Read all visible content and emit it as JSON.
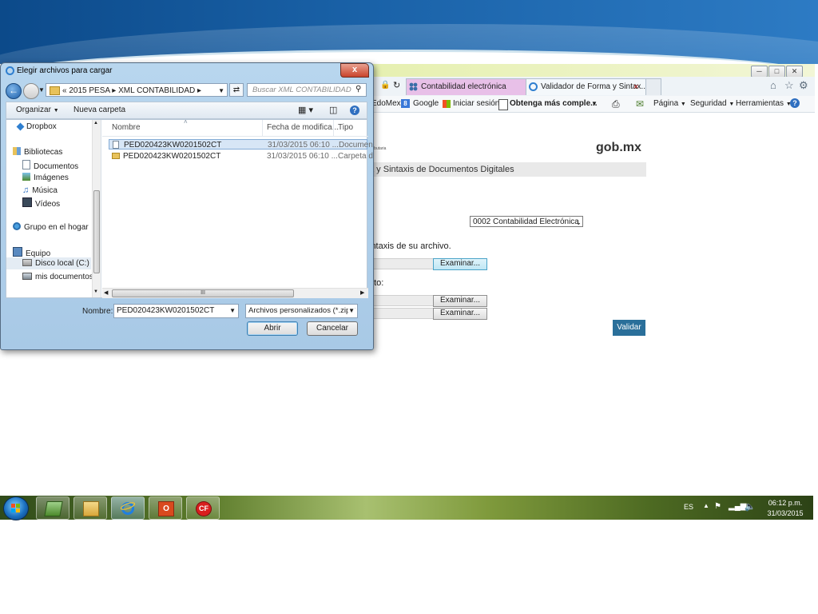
{
  "file_dialog": {
    "title": "Elegir archivos para cargar",
    "close_label": "x",
    "address_crumbs": [
      "«",
      "2015 PESA",
      "XML CONTABILIDAD"
    ],
    "search_placeholder": "Buscar XML CONTABILIDAD",
    "toolbar": {
      "organize_label": "Organizar",
      "new_folder_label": "Nueva carpeta"
    },
    "nav_items": [
      {
        "label": "Dropbox",
        "icon": "dropbox-icon"
      },
      {
        "label": "Bibliotecas",
        "icon": "libraries-icon"
      },
      {
        "label": "Documentos",
        "icon": "documents-icon"
      },
      {
        "label": "Imágenes",
        "icon": "pictures-icon"
      },
      {
        "label": "Música",
        "icon": "music-icon"
      },
      {
        "label": "Vídeos",
        "icon": "videos-icon"
      },
      {
        "label": "Grupo en el hogar",
        "icon": "homegroup-icon"
      },
      {
        "label": "Equipo",
        "icon": "computer-icon"
      },
      {
        "label": "Disco local (C:)",
        "icon": "drive-icon"
      },
      {
        "label": "mis documentos",
        "icon": "network-drive-icon"
      }
    ],
    "columns": [
      "Nombre",
      "Fecha de modifica...",
      "Tipo"
    ],
    "files": [
      {
        "name": "PED020423KW0201502CT",
        "date": "31/03/2015 06:10 ...",
        "type": "Documen"
      },
      {
        "name": "PED020423KW0201502CT",
        "date": "31/03/2015 06:10 ...",
        "type": "Carpeta d"
      }
    ],
    "filename_label": "Nombre:",
    "filename_value": "PED020423KW0201502CT",
    "filetype_value": "Archivos personalizados (*.zip;*",
    "open_label": "Abrir",
    "cancel_label": "Cancelar",
    "scroll_grip": "III"
  },
  "browser": {
    "tabs": [
      {
        "label": "Contabilidad electrónica"
      },
      {
        "label": "Validador de Forma y Sintax..."
      }
    ],
    "tab_close": "×",
    "favorites": [
      "EdoMex",
      "Google",
      "Iniciar sesión",
      "Obtenga más comple...",
      "Página",
      "Seguridad",
      "Herramientas"
    ]
  },
  "page": {
    "small_caption": "tributaria",
    "logo_text": "gob.mx",
    "subtitle": "a y Sintaxis de Documentos Digitales",
    "select_value": "0002 Contabilidad Electrónica",
    "instruction_1": "intaxis de su archivo.",
    "instruction_2": "nto:",
    "browse_label": "Examinar...",
    "validate_label": "Validar"
  },
  "taskbar": {
    "language": "ES",
    "time": "06:12 p.m.",
    "date": "31/03/2015",
    "app_labels": {
      "office": "O",
      "cf": "CF"
    }
  },
  "colors": {
    "banner": "#1a62a8",
    "tab_active": "#e8c0e8",
    "validate_button": "#2a6f9a",
    "selected_row": "#d7e6f6"
  }
}
